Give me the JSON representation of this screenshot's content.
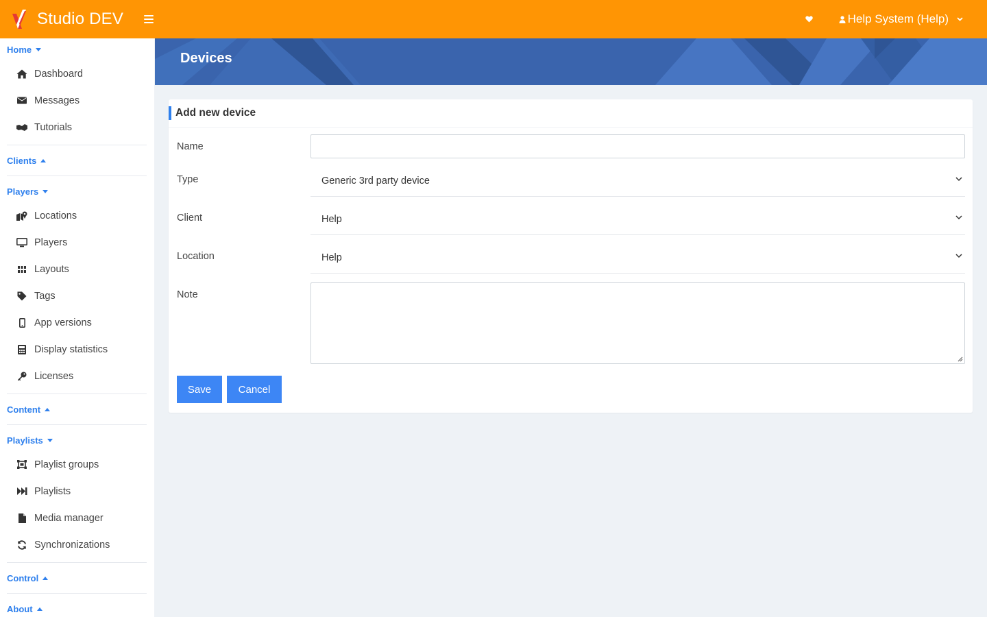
{
  "app": {
    "brand": "Studio DEV",
    "user_label": "Help System (Help)",
    "accent_color": "#ff9504",
    "link_color": "#2f80ed",
    "primary_button_color": "#3d86f5"
  },
  "sidebar": {
    "sections": [
      {
        "label": "Home",
        "expanded": true,
        "items": [
          {
            "label": "Dashboard",
            "icon": "home-icon"
          },
          {
            "label": "Messages",
            "icon": "envelope-icon"
          },
          {
            "label": "Tutorials",
            "icon": "handshake-icon"
          }
        ]
      },
      {
        "label": "Clients",
        "expanded": false,
        "items": []
      },
      {
        "label": "Players",
        "expanded": true,
        "items": [
          {
            "label": "Locations",
            "icon": "map-marker-icon"
          },
          {
            "label": "Players",
            "icon": "monitor-icon"
          },
          {
            "label": "Layouts",
            "icon": "grid-icon"
          },
          {
            "label": "Tags",
            "icon": "tag-icon"
          },
          {
            "label": "App versions",
            "icon": "mobile-icon"
          },
          {
            "label": "Display statistics",
            "icon": "calculator-icon"
          },
          {
            "label": "Licenses",
            "icon": "key-icon"
          }
        ]
      },
      {
        "label": "Content",
        "expanded": false,
        "items": []
      },
      {
        "label": "Playlists",
        "expanded": true,
        "items": [
          {
            "label": "Playlist groups",
            "icon": "object-group-icon"
          },
          {
            "label": "Playlists",
            "icon": "fast-forward-icon"
          },
          {
            "label": "Media manager",
            "icon": "file-icon"
          },
          {
            "label": "Synchronizations",
            "icon": "sync-icon"
          }
        ]
      },
      {
        "label": "Control",
        "expanded": false,
        "items": []
      },
      {
        "label": "About",
        "expanded": false,
        "items": []
      }
    ]
  },
  "page": {
    "title": "Devices"
  },
  "form": {
    "title": "Add new device",
    "name_label": "Name",
    "name_value": "",
    "type_label": "Type",
    "type_value": "Generic 3rd party device",
    "client_label": "Client",
    "client_value": "Help",
    "location_label": "Location",
    "location_value": "Help",
    "note_label": "Note",
    "note_value": "",
    "save_label": "Save",
    "cancel_label": "Cancel"
  }
}
